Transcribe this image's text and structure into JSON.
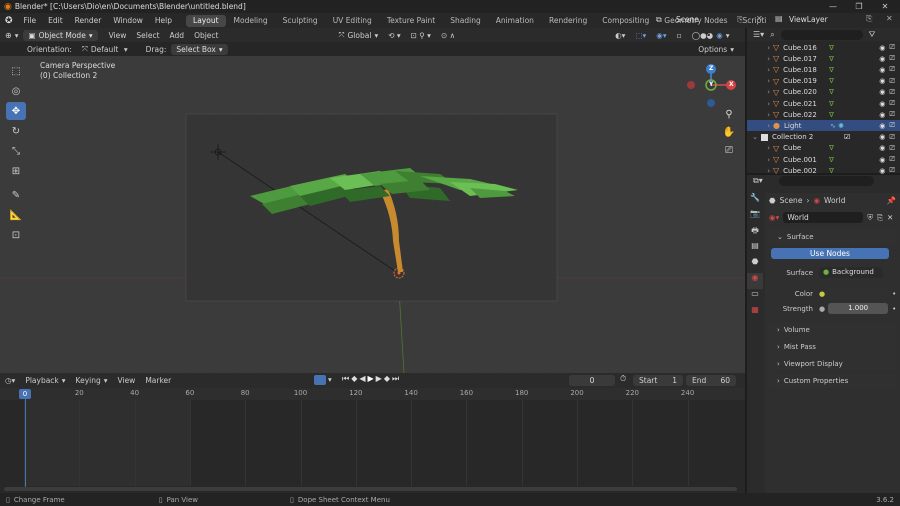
{
  "titlebar": {
    "title": "Blender* [C:\\Users\\Dio\\en\\Documents\\Blender\\untitled.blend]",
    "min": "—",
    "max": "❐",
    "close": "✕"
  },
  "menubar": {
    "menus": [
      "File",
      "Edit",
      "Render",
      "Window",
      "Help"
    ],
    "workspaces": [
      "Layout",
      "Modeling",
      "Sculpting",
      "UV Editing",
      "Texture Paint",
      "Shading",
      "Animation",
      "Rendering",
      "Compositing",
      "Geometry Nodes",
      "Scripting"
    ],
    "active_workspace": "Layout",
    "scene": "Scene",
    "view_layer": "ViewLayer"
  },
  "viewport_header": {
    "mode": "Object Mode",
    "menus": [
      "View",
      "Select",
      "Add",
      "Object"
    ],
    "transform": "Global"
  },
  "tool_header": {
    "orientation_label": "Orientation:",
    "orientation_value": "Default",
    "drag_label": "Drag:",
    "drag_value": "Select Box",
    "options": "Options"
  },
  "viewport": {
    "camera_label": "Camera Perspective",
    "collection_label": "(0) Collection 2",
    "axis_x": "X",
    "axis_y": "Y",
    "axis_z": "Z"
  },
  "timeline_header": {
    "menus": [
      "Playback",
      "Keying",
      "View",
      "Marker"
    ],
    "current_frame": "0",
    "start_label": "Start",
    "start_value": "1",
    "end_label": "End",
    "end_value": "60"
  },
  "timeline": {
    "ticks": [
      "0",
      "20",
      "40",
      "60",
      "80",
      "100",
      "120",
      "140",
      "160",
      "180",
      "200",
      "220",
      "240"
    ]
  },
  "outliner": {
    "rows": [
      {
        "name": "Cube.016",
        "indent": 1
      },
      {
        "name": "Cube.017",
        "indent": 1
      },
      {
        "name": "Cube.018",
        "indent": 1
      },
      {
        "name": "Cube.019",
        "indent": 1
      },
      {
        "name": "Cube.020",
        "indent": 1
      },
      {
        "name": "Cube.021",
        "indent": 1
      },
      {
        "name": "Cube.022",
        "indent": 1
      },
      {
        "name": "Light",
        "indent": 1
      },
      {
        "name": "Collection 2",
        "indent": 0
      },
      {
        "name": "Cube",
        "indent": 1
      },
      {
        "name": "Cube.001",
        "indent": 1
      },
      {
        "name": "Cube.002",
        "indent": 1
      }
    ],
    "selected": "Light"
  },
  "properties": {
    "breadcrumb_scene": "Scene",
    "breadcrumb_world": "World",
    "world_name": "World",
    "surface_panel": "Surface",
    "use_nodes": "Use Nodes",
    "surface_label": "Surface",
    "surface_value": "Background",
    "color_label": "Color",
    "strength_label": "Strength",
    "strength_value": "1.000",
    "panels": [
      "Volume",
      "Mist Pass",
      "Viewport Display",
      "Custom Properties"
    ]
  },
  "statusbar": {
    "items": [
      "Change Frame",
      "Pan View",
      "Dope Sheet Context Menu"
    ],
    "version": "3.6.2"
  },
  "colors": {
    "accent": "#4772b3",
    "selected_row": "#334d80",
    "object_orange": "#e0904c"
  }
}
